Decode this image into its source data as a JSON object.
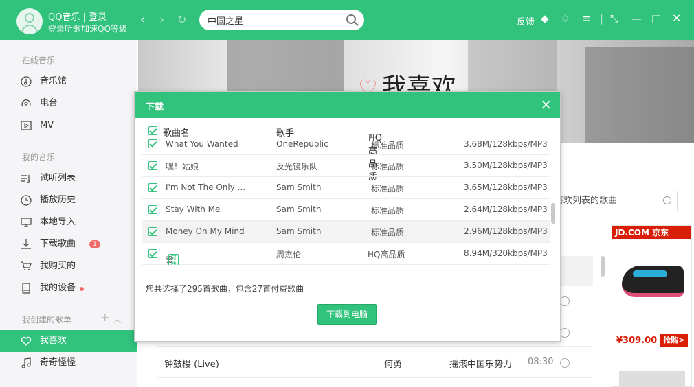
{
  "titlebar": {
    "user_line1": "QQ音乐 | 登录",
    "user_line2": "登录听歌加速QQ等级",
    "search_value": "中国之星",
    "feedback": "反馈"
  },
  "sidebar": {
    "section_online": "在线音乐",
    "online_items": [
      {
        "label": "音乐馆",
        "icon": "music-hall-icon"
      },
      {
        "label": "电台",
        "icon": "radio-icon"
      },
      {
        "label": "MV",
        "icon": "mv-icon"
      }
    ],
    "section_mine": "我的音乐",
    "mine_items": [
      {
        "label": "试听列表",
        "icon": "playlist-icon"
      },
      {
        "label": "播放历史",
        "icon": "history-icon"
      },
      {
        "label": "本地导入",
        "icon": "local-import-icon"
      },
      {
        "label": "下载歌曲",
        "icon": "download-icon",
        "badge": "1"
      },
      {
        "label": "我购买的",
        "icon": "cart-icon"
      },
      {
        "label": "我的设备",
        "icon": "device-icon"
      }
    ],
    "section_created": "我创建的歌单",
    "created_items": [
      {
        "label": "我喜欢",
        "icon": "heart-icon",
        "active": true
      },
      {
        "label": "奇奇怪怪",
        "icon": "music-note-icon"
      }
    ]
  },
  "main": {
    "banner_title": "我喜欢",
    "search_placeholder": "我喜欢列表的歌曲",
    "visible_row": {
      "title": "钟鼓楼 (Live)",
      "artist": "何勇",
      "album": "摇滚中国乐势力",
      "duration": "08:30"
    }
  },
  "ad": {
    "brand": "JD.COM 京东",
    "price": "¥309.00",
    "buy_label": "抢购>"
  },
  "dialog": {
    "title": "下载",
    "headers": {
      "name": "歌曲名",
      "artist": "歌手",
      "quality": "HQ高品质"
    },
    "rows": [
      {
        "name": "What You Wanted",
        "artist": "OneRepublic",
        "quality": "标准品质",
        "size": "3.68M/128kbps/MP3",
        "paid": false
      },
      {
        "name": "嘿！姑娘",
        "artist": "反光镜乐队",
        "quality": "标准品质",
        "size": "3.50M/128kbps/MP3",
        "paid": false
      },
      {
        "name": "I'm Not The Only ...",
        "artist": "Sam Smith",
        "quality": "标准品质",
        "size": "3.65M/128kbps/MP3",
        "paid": false
      },
      {
        "name": "Stay With Me",
        "artist": "Sam Smith",
        "quality": "标准品质",
        "size": "2.64M/128kbps/MP3",
        "paid": false
      },
      {
        "name": "Money On My Mind",
        "artist": "Sam Smith",
        "quality": "标准品质",
        "size": "2.96M/128kbps/MP3",
        "paid": false,
        "highlighted": true
      },
      {
        "name": "爱在西元前",
        "artist": "周杰伦",
        "quality": "HQ高品质",
        "size": "8.94M/320kbps/MP3",
        "paid": true,
        "paid_label": "付费"
      }
    ],
    "summary": "您共选择了295首歌曲，包含27首付费歌曲",
    "download_button": "下载到电脑"
  },
  "colors": {
    "accent": "#31c27c",
    "badge": "#f06a6a",
    "jd_red": "#d81e06"
  }
}
